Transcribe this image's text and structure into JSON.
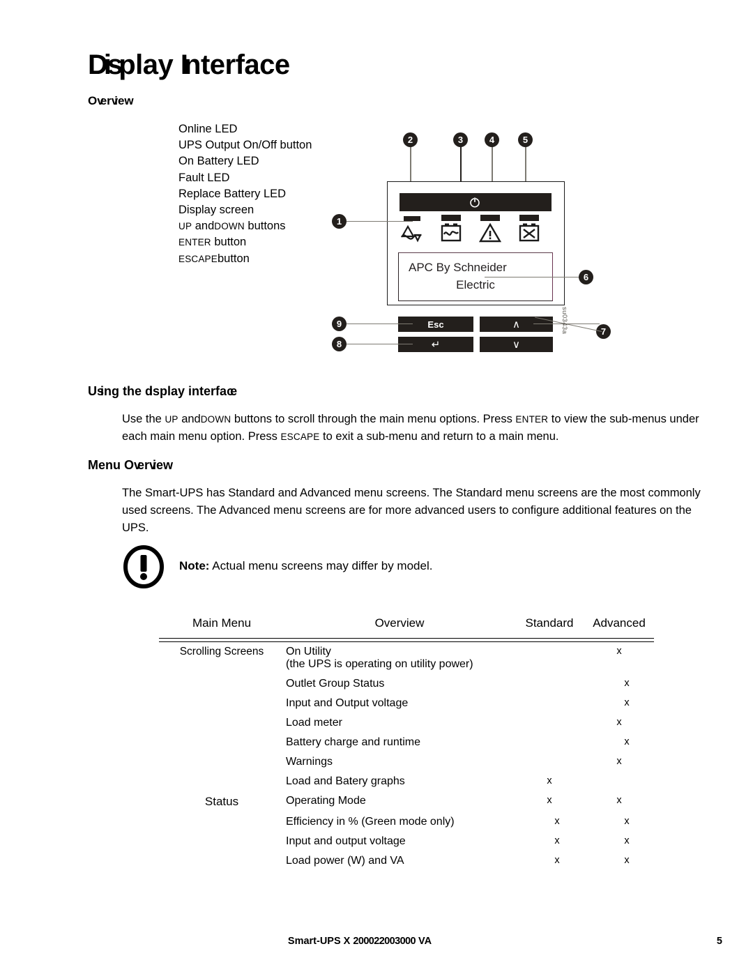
{
  "page": {
    "title": "Display Interface",
    "title_parts": [
      "D",
      "is",
      "play ",
      "I",
      "nterfa",
      "ce"
    ]
  },
  "sections": {
    "overview_heading": "Overview",
    "using_heading": "Using the display interface",
    "menu_heading": "Menu Overview"
  },
  "overview_list": [
    {
      "id": 1,
      "label": "Online LED"
    },
    {
      "id": 2,
      "label": "UPS Output On/Off button"
    },
    {
      "id": 3,
      "label": "On Battery LED"
    },
    {
      "id": 4,
      "label": "Fault LED"
    },
    {
      "id": 5,
      "label": "Replace Battery LED"
    },
    {
      "id": 6,
      "label": "Display screen"
    },
    {
      "id": 7,
      "label": "UP and DOWN buttons"
    },
    {
      "id": 8,
      "label": "ENTER button"
    },
    {
      "id": 9,
      "label": "ESCAPE button"
    }
  ],
  "overview_list_tokens": {
    "item7": {
      "pre": "UP",
      "mid": " and",
      "post": "DOWN",
      "tail": " buttons"
    },
    "item8": {
      "pre": "ENTER",
      "tail": " button"
    },
    "item9": {
      "pre": "ESCAPE",
      "tail": "button"
    }
  },
  "figure": {
    "screen_line1": "APC By Schneider",
    "screen_line2": "Electric",
    "buttons": {
      "esc": "Esc",
      "enter_glyph": "↵",
      "up_glyph": "∧",
      "down_glyph": "∨"
    },
    "callouts": [
      "1",
      "2",
      "3",
      "4",
      "5",
      "6",
      "7",
      "8",
      "9"
    ],
    "reference_code": "su0343a",
    "icons": {
      "power": "power-button-icon",
      "led1": "online-ac-waveform-icon",
      "led2": "on-battery-icon",
      "led3": "fault-warning-triangle-icon",
      "led4": "replace-battery-icon"
    }
  },
  "paragraphs": {
    "using": {
      "t1": "Use the ",
      "up": "UP",
      "t2": " and",
      "down": "DOWN",
      "t3": " buttons to scroll through the main menu options. Press ",
      "enter": "ENTER",
      "t4": " to view the sub-menus under each main menu option. Press ",
      "escape": "ESCAPE",
      "t5": " to exit a sub-menu and return to a main menu."
    },
    "menu": "The Smart-UPS has Standard and Advanced menu screens. The Standard menu screens are the most commonly used screens. The Advanced menu screens are for more advanced users to configure additional features on the UPS."
  },
  "note": {
    "label": "Note:",
    "text": " Actual menu screens may differ by model.",
    "icon": "exclamation-circle-icon"
  },
  "table": {
    "headers": {
      "main_menu": "Main Menu",
      "overview": "Overview",
      "standard": "Standard",
      "advanced": "Advanced"
    },
    "rows": [
      {
        "main_menu": "Scrolling Screens",
        "overview": "On Utility",
        "overview_sub": "(the UPS is operating on utility power)",
        "standard": "",
        "advanced": "x",
        "indent": 1
      },
      {
        "main_menu": "",
        "overview": "Outlet Group Status",
        "standard": "",
        "advanced": "x",
        "indent": 2
      },
      {
        "main_menu": "",
        "overview": "Input and Output voltage",
        "standard": "",
        "advanced": "x",
        "indent": 2
      },
      {
        "main_menu": "",
        "overview": "Load meter",
        "standard": "",
        "advanced": "x",
        "indent": 1
      },
      {
        "main_menu": "",
        "overview": "Battery charge and runtime",
        "standard": "",
        "advanced": "x",
        "indent": 2
      },
      {
        "main_menu": "",
        "overview": "Warnings",
        "standard": "",
        "advanced": "x",
        "indent": 1
      },
      {
        "main_menu": "",
        "overview": "Load and Battery graphs",
        "standard": "x",
        "advanced": "",
        "indent": 1
      },
      {
        "main_menu": "Status",
        "overview": "Operating Mode",
        "standard": "x",
        "advanced": "x",
        "indent": 1
      },
      {
        "main_menu": "",
        "overview": "Efficiency in % (Green mode only)",
        "standard": "x",
        "advanced": "x",
        "indent": 2
      },
      {
        "main_menu": "",
        "overview": "Input and output voltage",
        "standard": "x",
        "advanced": "x",
        "indent": 2
      },
      {
        "main_menu": "",
        "overview": "Load power (W) and VA",
        "standard": "x",
        "advanced": "x",
        "indent": 2
      }
    ]
  },
  "footer": {
    "product": "Smart-UPS X 2000 2200 3000 VA",
    "product_parts": [
      "Smart-UPS X ",
      "2000",
      "2200",
      "3000",
      " VA"
    ],
    "page_number": "5"
  },
  "colors": {
    "ink": "#000000",
    "device_dark": "#231f1c",
    "leader": "#7d7a72",
    "screen_tint": "#6a3350"
  }
}
